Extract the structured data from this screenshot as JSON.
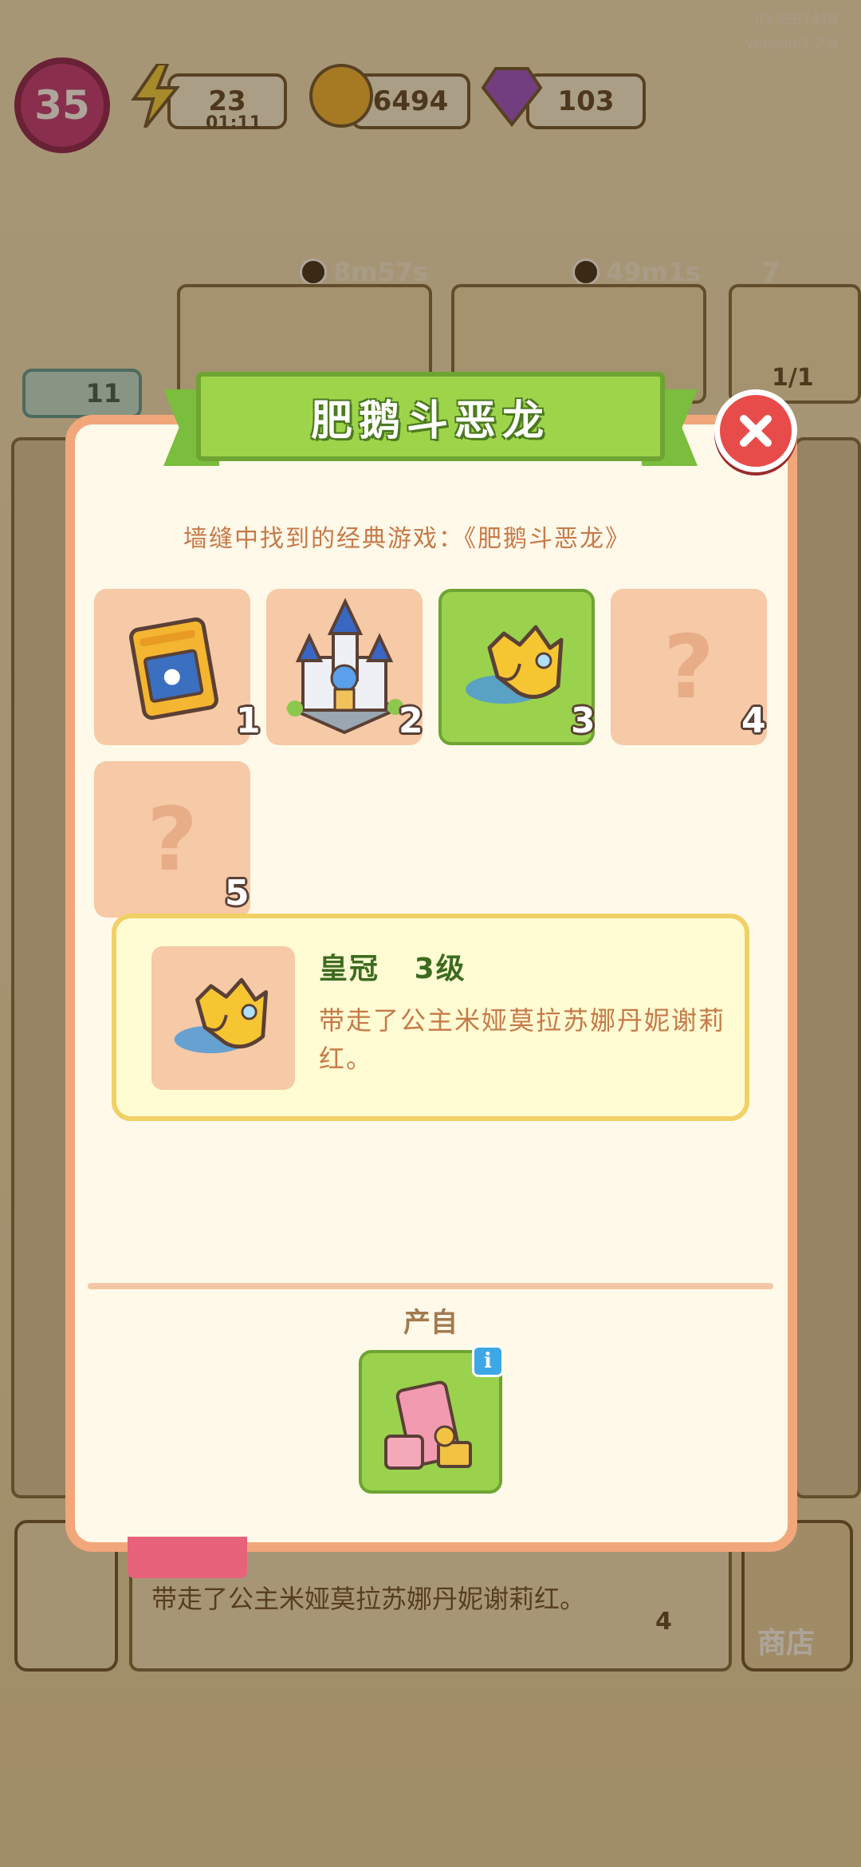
{
  "hud": {
    "id_text": "ID:3557419",
    "version_text": "Version:2.2.8",
    "level": "35",
    "energy": "23",
    "energy_timer": "01:11",
    "coins": "6494",
    "gems": "103",
    "producer_timer_1": "8m57s",
    "producer_timer_2": "49m1s",
    "star_count": "7",
    "progress_text": "1/1",
    "goose_star_count": "11"
  },
  "modal": {
    "title": "肥鹅斗恶龙",
    "subtitle": "墙缝中找到的经典游戏：《肥鹅斗恶龙》",
    "slots": [
      {
        "num": "1",
        "item": "game-cartridge",
        "unlocked": true
      },
      {
        "num": "2",
        "item": "castle",
        "unlocked": true
      },
      {
        "num": "3",
        "item": "crown",
        "unlocked": true,
        "selected": true
      },
      {
        "num": "4",
        "item": "unknown",
        "unlocked": false,
        "mark": "?"
      },
      {
        "num": "5",
        "item": "unknown",
        "unlocked": false,
        "mark": "?"
      }
    ],
    "detail": {
      "name": "皇冠   3级",
      "description": "带走了公主米娅莫拉苏娜丹妮谢莉红。"
    },
    "source_label": "产自",
    "info_glyph": "i"
  },
  "background": {
    "bottom_text": "带走了公主米娅莫拉苏娜丹妮谢莉红。",
    "shop_label": "商店",
    "coin_count": "4"
  },
  "colors": {
    "modal_border": "#f2a77b",
    "ribbon_green": "#9ed44a",
    "slot_locked": "#f6c9a7",
    "slot_selected": "#9bd24d",
    "detail_border": "#f1d066",
    "close_red": "#e84c4a",
    "text_orange": "#c67a49",
    "text_green": "#3d6b1f"
  }
}
